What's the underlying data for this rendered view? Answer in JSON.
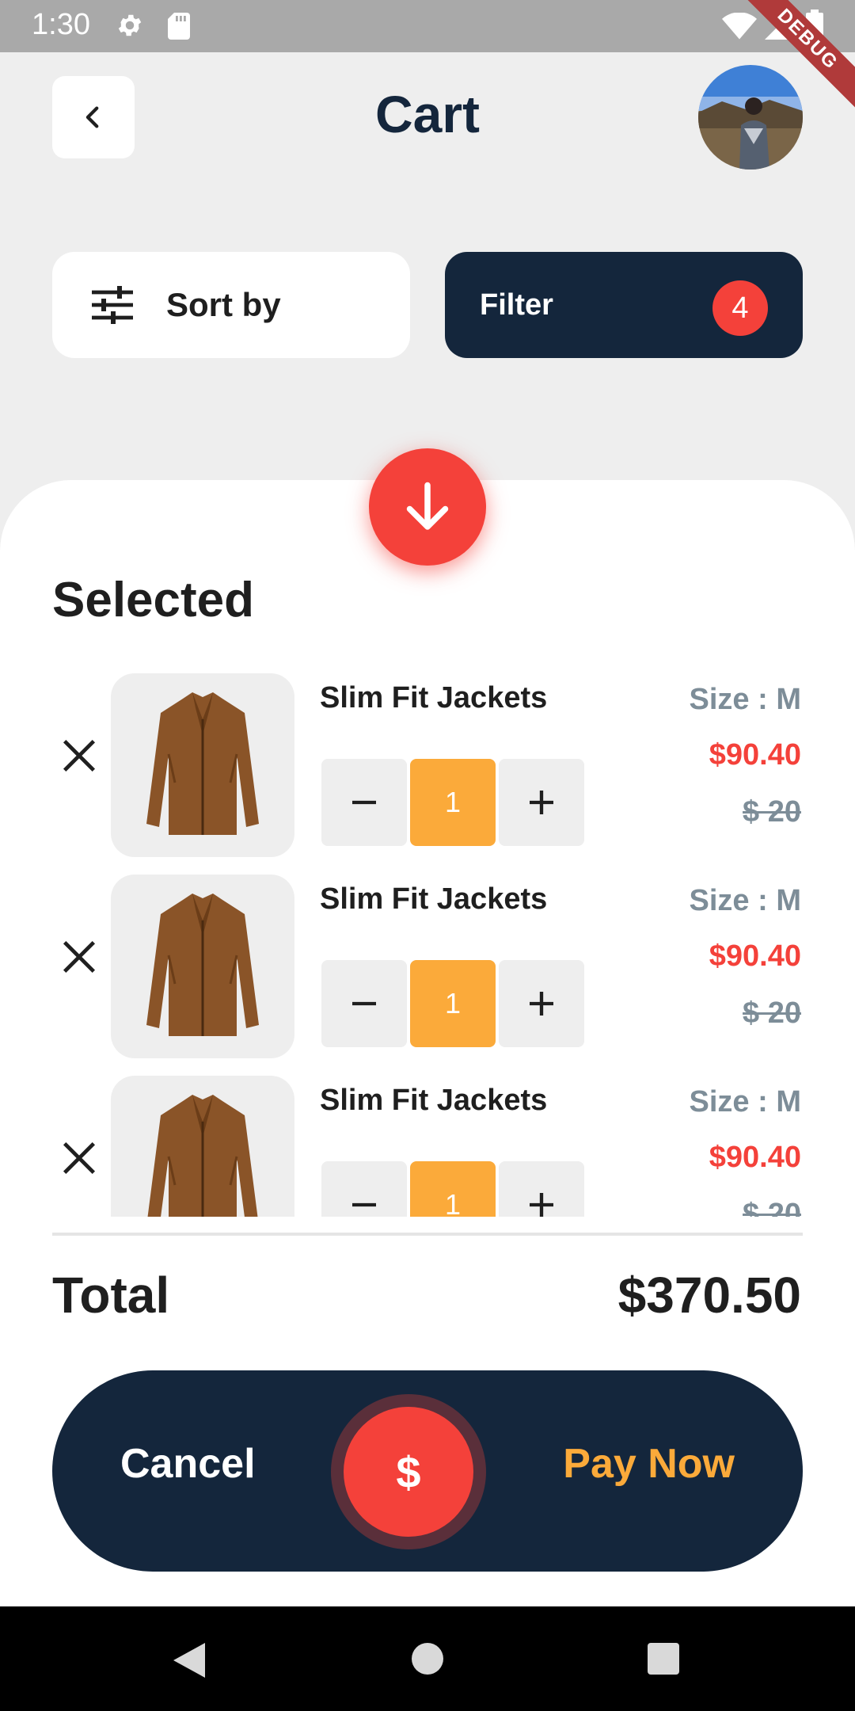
{
  "status_bar": {
    "time": "1:30",
    "debug_label": "DEBUG"
  },
  "header": {
    "title": "Cart"
  },
  "toolbar": {
    "sort_label": "Sort by",
    "filter_label": "Filter",
    "filter_count": "4"
  },
  "section": {
    "title": "Selected"
  },
  "items": [
    {
      "name": "Slim Fit Jackets",
      "quantity": "1",
      "size": "Size : M",
      "price": "$90.40",
      "old_price": "$ 20"
    },
    {
      "name": "Slim Fit Jackets",
      "quantity": "1",
      "size": "Size : M",
      "price": "$90.40",
      "old_price": "$ 20"
    },
    {
      "name": "Slim Fit Jackets",
      "quantity": "1",
      "size": "Size : M",
      "price": "$90.40",
      "old_price": "$ 20"
    }
  ],
  "summary": {
    "total_label": "Total",
    "total_value": "$370.50"
  },
  "actions": {
    "cancel_label": "Cancel",
    "pay_label": "Pay Now",
    "currency_symbol": "$"
  },
  "colors": {
    "navy": "#14263c",
    "accent_red": "#f4413a",
    "accent_orange": "#fbaa3a",
    "muted": "#7d8d98"
  }
}
